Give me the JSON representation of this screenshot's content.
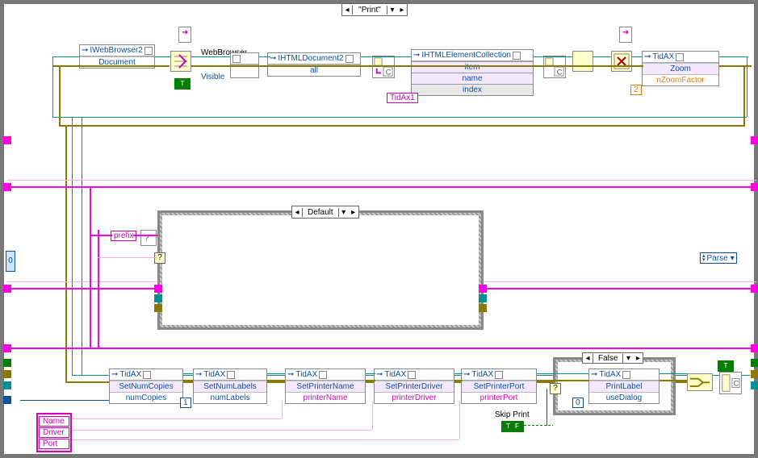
{
  "case_outer": "\"Print\"",
  "top_nodes": {
    "iwebbrowser2": {
      "class": "IWebBrowser2",
      "prop": "Document"
    },
    "webbrowser_label": "WebBrowser",
    "visible_prop": "Visible",
    "ihtmldoc": {
      "class": "IHTMLDocument2",
      "prop": "all"
    },
    "ihtmlelem": {
      "class": "IHTMLElementCollection",
      "item": "item",
      "name": "name",
      "index": "index"
    },
    "tidax_zoom": {
      "class": "TidAX",
      "method": "Zoom",
      "param": "nZoomFactor"
    },
    "tidax1_const": "TidAx1",
    "zoom_factor_const": "2"
  },
  "middle": {
    "case_label": "Default",
    "prefix_label": "prefix",
    "parse_label": "Parse"
  },
  "inner_false": {
    "case_label": "False",
    "tidax": {
      "class": "TidAX",
      "method": "PrintLabel",
      "param": "useDialog"
    },
    "zero_const": "0"
  },
  "bottom_invokes": {
    "n1": {
      "class": "TidAX",
      "method": "SetNumCopies",
      "param": "numCopies"
    },
    "n2": {
      "class": "TidAX",
      "method": "SetNumLabels",
      "param": "numLabels"
    },
    "n3": {
      "class": "TidAX",
      "method": "SetPrinterName",
      "param": "printerName"
    },
    "n4": {
      "class": "TidAX",
      "method": "SetPrinterDriver",
      "param": "printerDriver"
    },
    "n5": {
      "class": "TidAX",
      "method": "SetPrinterPort",
      "param": "printerPort"
    },
    "one_const": "1",
    "skip_print_label": "Skip Print",
    "skip_print_value": "T F"
  },
  "cluster": {
    "name": "Name",
    "driver": "Driver",
    "port": "Port"
  },
  "bool_true": "T",
  "bool_true2": "T"
}
